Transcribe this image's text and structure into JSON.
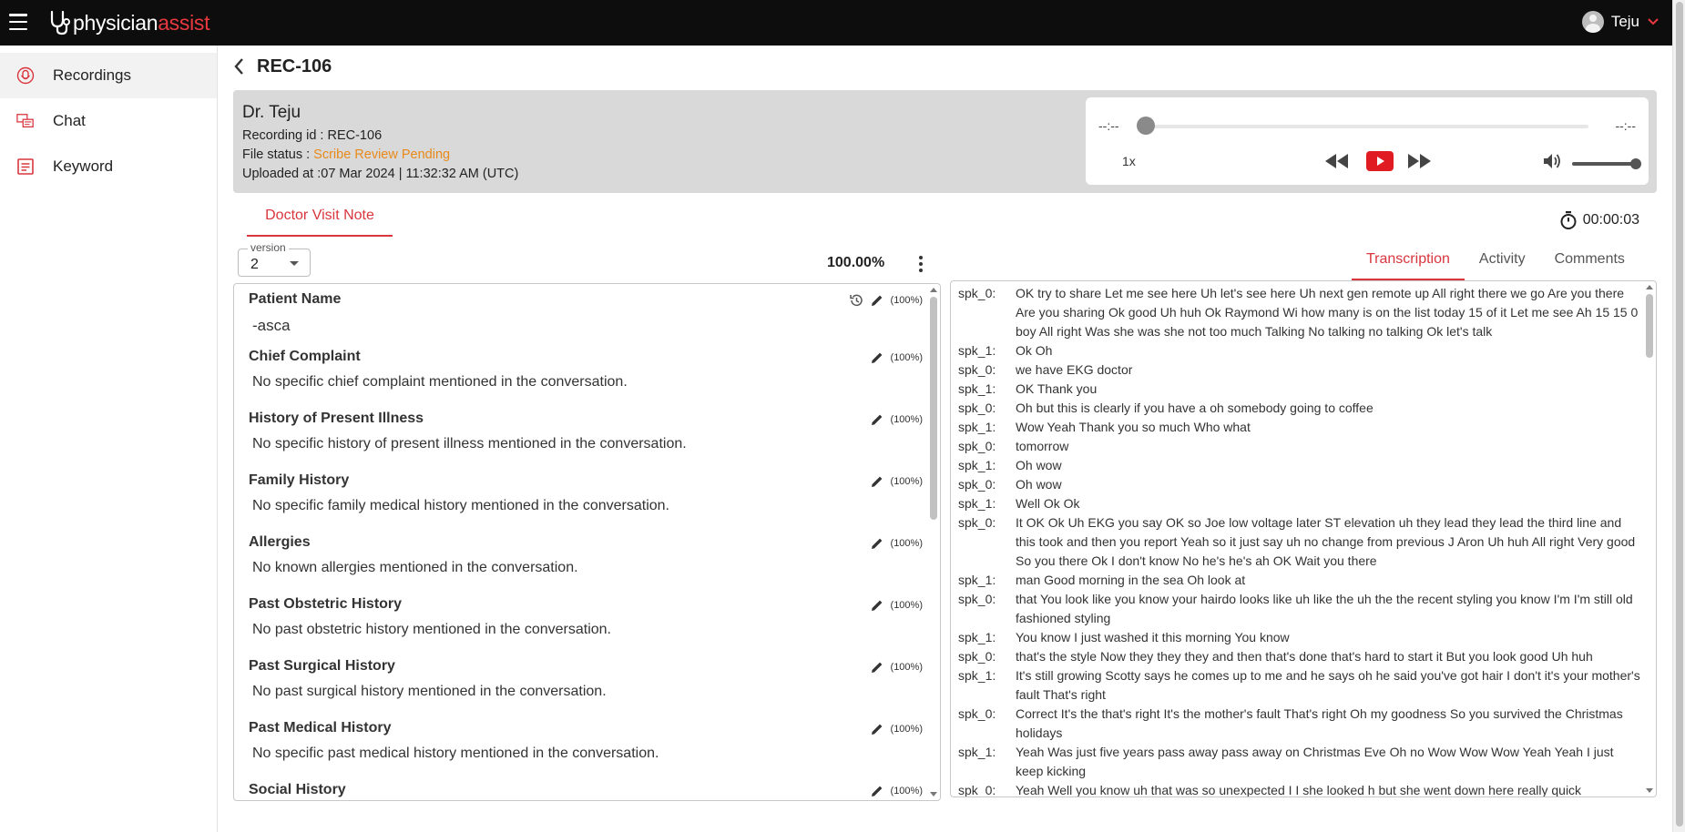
{
  "app": {
    "logo_physician": "physician",
    "logo_assist": "assist",
    "user_name": "Teju"
  },
  "sidebar": {
    "items": [
      {
        "label": "Recordings",
        "icon": "recordings-icon",
        "active": true
      },
      {
        "label": "Chat",
        "icon": "chat-icon",
        "active": false
      },
      {
        "label": "Keyword",
        "icon": "keyword-icon",
        "active": false
      }
    ]
  },
  "header": {
    "title": "REC-106"
  },
  "recording": {
    "doctor": "Dr. Teju",
    "id_line": "Recording id : REC-106",
    "status_label": "File status : ",
    "status_value": "Scribe Review Pending",
    "uploaded": "Uploaded at :07 Mar 2024 | 11:32:32 AM (UTC)",
    "status_color": "#e88a1a"
  },
  "player": {
    "time_current": "--:--",
    "time_total": "--:--",
    "speed": "1x",
    "progress": 0,
    "volume": 1.0
  },
  "note": {
    "tab_label": "Doctor Visit Note",
    "timer": "00:00:03",
    "version_legend": "version",
    "version_value": "2",
    "overall_percent": "100.00%",
    "sections": [
      {
        "title": "Patient Name",
        "body": "-asca",
        "pct": "(100%)"
      },
      {
        "title": "Chief Complaint",
        "body": "No specific chief complaint mentioned in the conversation.",
        "pct": "(100%)"
      },
      {
        "title": "History of Present Illness",
        "body": "No specific history of present illness mentioned in the conversation.",
        "pct": "(100%)"
      },
      {
        "title": "Family History",
        "body": "No specific family medical history mentioned in the conversation.",
        "pct": "(100%)"
      },
      {
        "title": "Allergies",
        "body": "No known allergies mentioned in the conversation.",
        "pct": "(100%)"
      },
      {
        "title": "Past Obstetric History",
        "body": "No past obstetric history mentioned in the conversation.",
        "pct": "(100%)"
      },
      {
        "title": "Past Surgical History",
        "body": "No past surgical history mentioned in the conversation.",
        "pct": "(100%)"
      },
      {
        "title": "Past Medical History",
        "body": "No specific past medical history mentioned in the conversation.",
        "pct": "(100%)"
      },
      {
        "title": "Social History",
        "body": "",
        "pct": "(100%)"
      }
    ]
  },
  "right_tabs": {
    "transcription": "Transcription",
    "activity": "Activity",
    "comments": "Comments"
  },
  "transcript": [
    {
      "spk": "spk_0:",
      "text": "OK try to share Let me see here Uh let's see here Uh next gen remote up All right there we go Are you there Are you sharing Ok good Uh huh Ok Raymond Wi how many is on the list today 15 of it Let me see Ah 15 15 0 boy All right Was she was she not too much Talking No talking no talking Ok let's talk"
    },
    {
      "spk": "spk_1:",
      "text": "Ok Oh"
    },
    {
      "spk": "spk_0:",
      "text": "we have EKG doctor"
    },
    {
      "spk": "spk_1:",
      "text": "OK Thank you"
    },
    {
      "spk": "spk_0:",
      "text": "Oh but this is clearly if you have a oh somebody going to coffee"
    },
    {
      "spk": "spk_1:",
      "text": "Wow Yeah Thank you so much Who what"
    },
    {
      "spk": "spk_0:",
      "text": "tomorrow"
    },
    {
      "spk": "spk_1:",
      "text": "Oh wow"
    },
    {
      "spk": "spk_0:",
      "text": "Oh wow"
    },
    {
      "spk": "spk_1:",
      "text": "Well Ok Ok"
    },
    {
      "spk": "spk_0:",
      "text": "It OK Ok Uh EKG you say OK so Joe low voltage later ST elevation uh they lead they lead the third line and this took and then you report Yeah so it just say uh no change from previous J Aron Uh huh All right Very good So you there Ok I don't know No he's he's ah OK Wait you there"
    },
    {
      "spk": "spk_1:",
      "text": "man Good morning in the sea Oh look at"
    },
    {
      "spk": "spk_0:",
      "text": "that You look like you know your hairdo looks like uh like the uh the the recent styling you know I'm I'm still old fashioned styling"
    },
    {
      "spk": "spk_1:",
      "text": "You know I just washed it this morning You know"
    },
    {
      "spk": "spk_0:",
      "text": "that's the style Now they they they and then that's done that's hard to start it But you look good Uh huh"
    },
    {
      "spk": "spk_1:",
      "text": "It's still growing Scotty says he comes up to me and he says oh he said you've got hair I don't it's your mother's fault That's right"
    },
    {
      "spk": "spk_0:",
      "text": "Correct It's the that's right It's the mother's fault That's right Oh my goodness So you survived the Christmas holidays"
    },
    {
      "spk": "spk_1:",
      "text": "Yeah Was just five years pass away pass away on Christmas Eve Oh no Wow Wow Wow Yeah Yeah I just keep kicking"
    },
    {
      "spk": "spk_0:",
      "text": "Yeah Well you know uh that was so unexpected I I she looked h but she went down here really quick"
    }
  ]
}
